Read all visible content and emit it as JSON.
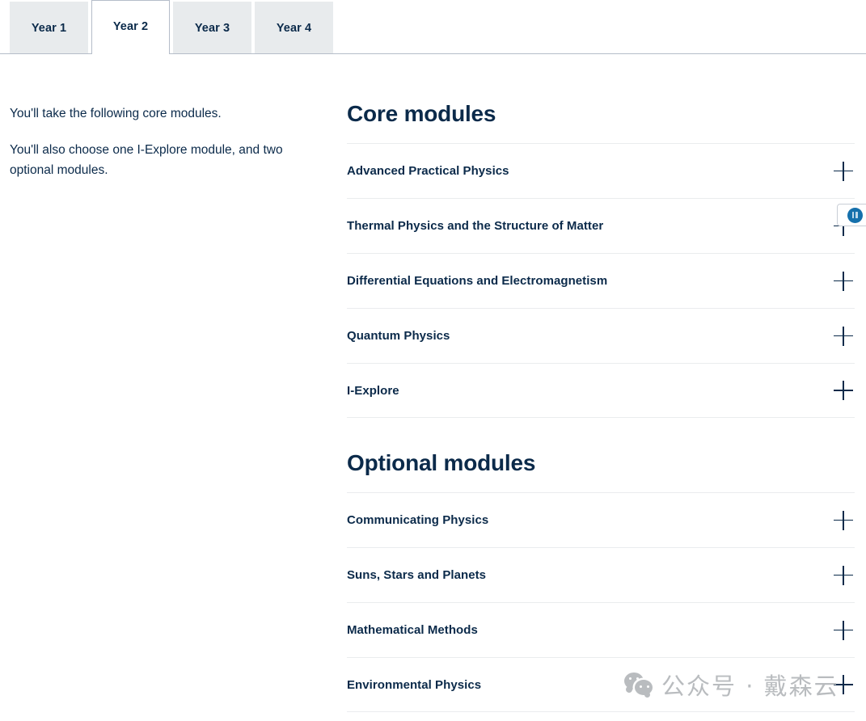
{
  "tabs": {
    "items": [
      {
        "label": "Year 1",
        "active": false
      },
      {
        "label": "Year 2",
        "active": true
      },
      {
        "label": "Year 3",
        "active": false
      },
      {
        "label": "Year 4",
        "active": false
      }
    ]
  },
  "intro": {
    "paragraph_1": "You'll take the following core modules.",
    "paragraph_2": "You'll also choose one I-Explore module, and two optional modules."
  },
  "core": {
    "title": "Core modules",
    "modules": [
      {
        "label": "Advanced Practical Physics",
        "toggle": "plus-icon"
      },
      {
        "label": "Thermal Physics and the Structure of Matter",
        "toggle": "plus-icon"
      },
      {
        "label": "Differential Equations and Electromagnetism",
        "toggle": "plus-icon"
      },
      {
        "label": "Quantum Physics",
        "toggle": "plus-icon"
      },
      {
        "label": "I-Explore",
        "toggle": "plus-icon"
      }
    ]
  },
  "optional": {
    "title": "Optional modules",
    "modules": [
      {
        "label": "Communicating Physics",
        "toggle": "plus-icon"
      },
      {
        "label": "Suns, Stars and Planets",
        "toggle": "plus-icon"
      },
      {
        "label": "Mathematical Methods",
        "toggle": "plus-icon"
      },
      {
        "label": "Environmental Physics",
        "toggle": "plus-icon"
      }
    ]
  },
  "media_widget": {
    "icon": "pause-icon",
    "label": ""
  },
  "watermark": {
    "icon": "wechat-icon",
    "text": "公众号 · 戴森云"
  },
  "colors": {
    "text_navy": "#0b2a4a",
    "tab_inactive_bg": "#e8ebed",
    "tab_border": "#b5bdc9",
    "divider": "#eaecee",
    "accent_blue": "#1570ac",
    "watermark_gray": "#b9bcbf"
  }
}
